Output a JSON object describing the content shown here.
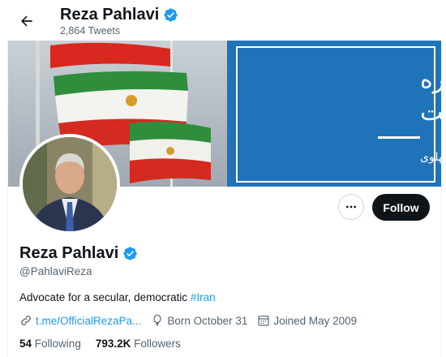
{
  "header": {
    "name": "Reza Pahlavi",
    "tweet_count": "2,864 Tweets"
  },
  "banner": {
    "line1": "ایران را دوباره",
    "line2": "خواهیم ساخت",
    "signature": "رضا پهلوی"
  },
  "actions": {
    "follow_label": "Follow"
  },
  "profile": {
    "name": "Reza Pahlavi",
    "handle": "@PahlaviReza",
    "bio_text": "Advocate for a secular, democratic ",
    "bio_hashtag": "#Iran",
    "link": "t.me/OfficialRezaPa...",
    "birthday": "Born October 31",
    "joined": "Joined May 2009"
  },
  "stats": {
    "following_count": "54",
    "following_label": "Following",
    "followers_count": "793.2K",
    "followers_label": "Followers"
  },
  "colors": {
    "accent": "#1d9bf0",
    "banner_blue": "#1f73b8",
    "flag_green": "#239f40",
    "flag_red": "#da0000"
  }
}
